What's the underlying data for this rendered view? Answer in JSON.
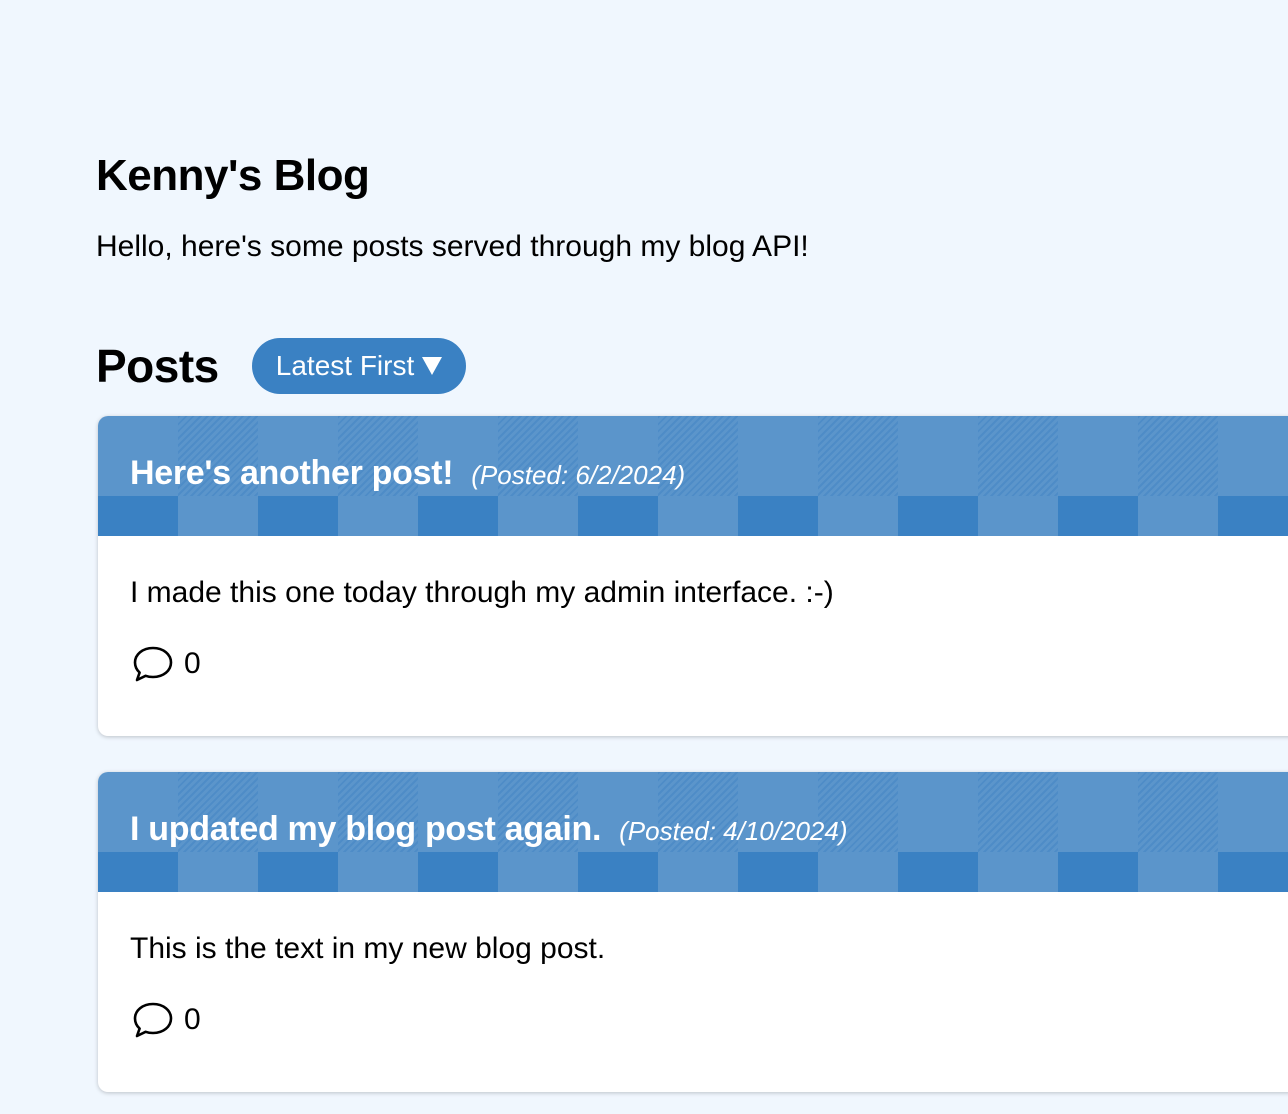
{
  "blog": {
    "title": "Kenny's Blog",
    "intro": "Hello, here's some posts served through my blog API!"
  },
  "posts_section": {
    "title": "Posts",
    "sort_label": "Latest First"
  },
  "posts": [
    {
      "title": "Here's another post!",
      "date": "(Posted: 6/2/2024)",
      "body": "I made this one today through my admin interface. :-)",
      "comment_count": "0"
    },
    {
      "title": "I updated my blog post again.",
      "date": "(Posted: 4/10/2024)",
      "body": "This is the text in my new blog post.",
      "comment_count": "0"
    }
  ],
  "colors": {
    "page_background": "#f0f7fe",
    "accent": "#3a81c3",
    "header_light": "#5b95cb",
    "card_background": "#ffffff"
  },
  "icons": {
    "sort": "caret-down-icon",
    "comments": "speech-bubble-icon"
  }
}
